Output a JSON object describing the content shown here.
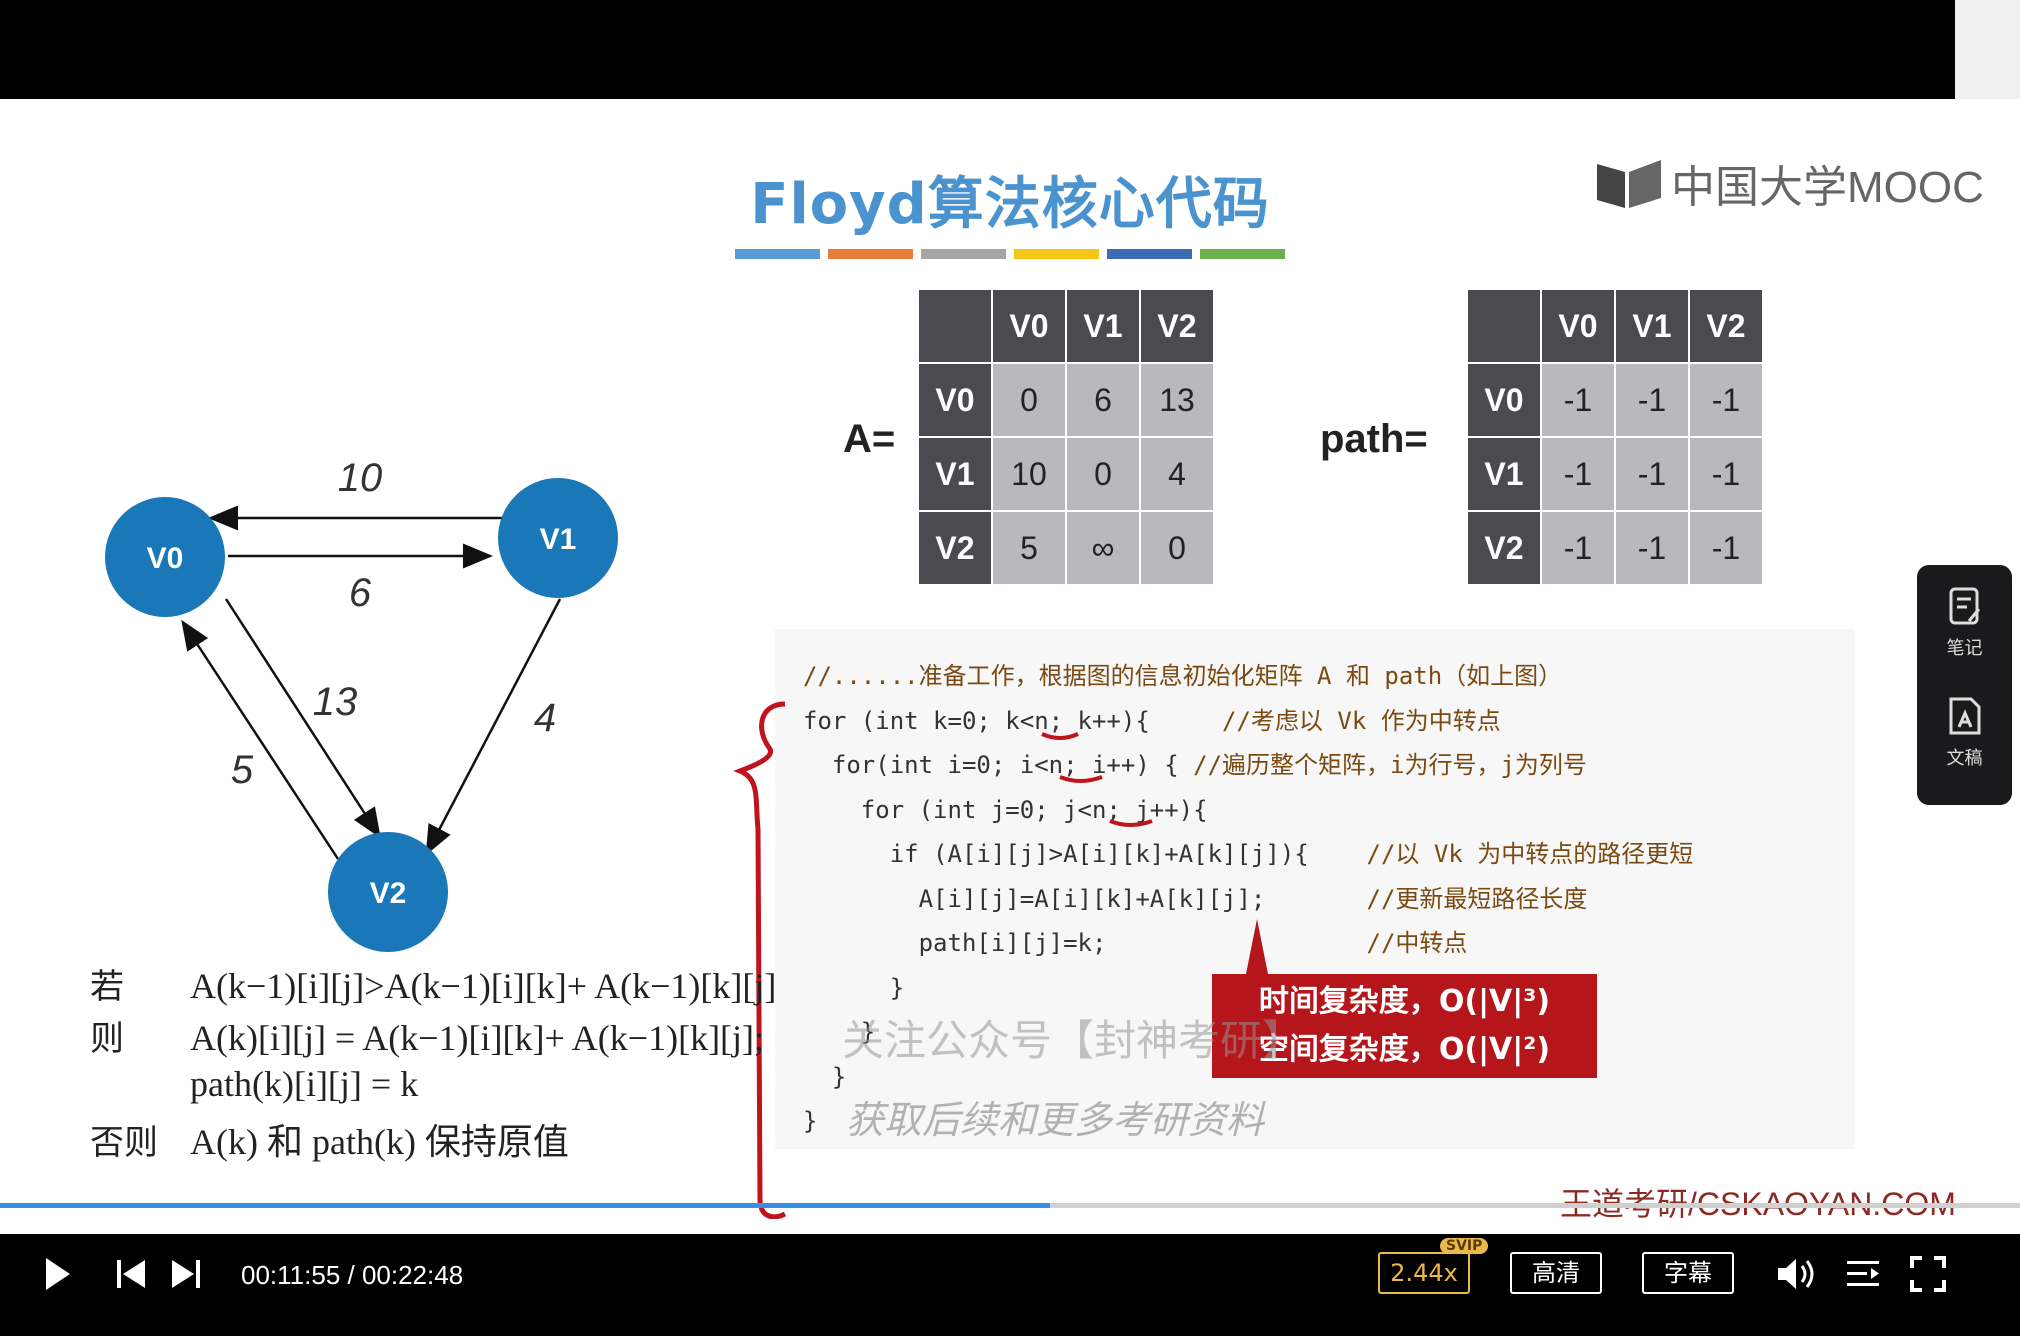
{
  "slide": {
    "title": "Floyd算法核心代码",
    "logo_text": "中国大学MOOC",
    "color_bars": [
      "#5b9bd5",
      "#e87e3a",
      "#a5a5a5",
      "#f5c518",
      "#3c6bb5",
      "#6ab04c"
    ],
    "graph": {
      "nodes": [
        "V0",
        "V1",
        "V2"
      ],
      "edge_labels": [
        "10",
        "6",
        "13",
        "4",
        "5"
      ]
    },
    "matrix_A": {
      "label": "A=",
      "headers": [
        "V0",
        "V1",
        "V2"
      ],
      "rows": [
        {
          "head": "V0",
          "cells": [
            "0",
            "6",
            "13"
          ]
        },
        {
          "head": "V1",
          "cells": [
            "10",
            "0",
            "4"
          ]
        },
        {
          "head": "V2",
          "cells": [
            "5",
            "∞",
            "0"
          ]
        }
      ]
    },
    "matrix_path": {
      "label": "path=",
      "headers": [
        "V0",
        "V1",
        "V2"
      ],
      "rows": [
        {
          "head": "V0",
          "cells": [
            "-1",
            "-1",
            "-1"
          ]
        },
        {
          "head": "V1",
          "cells": [
            "-1",
            "-1",
            "-1"
          ]
        },
        {
          "head": "V2",
          "cells": [
            "-1",
            "-1",
            "-1"
          ]
        }
      ]
    },
    "code": {
      "line1": "//......准备工作，根据图的信息初始化矩阵 A 和 path（如上图）",
      "line2_code": "for (int k=0; k<n; k++){",
      "line2_comment": "//考虑以 Vk 作为中转点",
      "line3_code": "  for(int i=0; i<n; i++) {",
      "line3_comment": "//遍历整个矩阵，i为行号，j为列号",
      "line4_code": "    for (int j=0; j<n; j++){",
      "line5_code": "      if (A[i][j]>A[i][k]+A[k][j]){",
      "line5_comment": "//以 Vk 为中转点的路径更短",
      "line6_code": "        A[i][j]=A[i][k]+A[k][j];",
      "line6_comment": "//更新最短路径长度",
      "line7_code": "        path[i][j]=k;",
      "line7_comment": "//中转点",
      "line8_code": "      }",
      "line9_code": "    }",
      "line10_code": "  }",
      "line11_code": "}"
    },
    "annotation": {
      "time_complexity": "时间复杂度，O(|V|³)",
      "space_complexity": "空间复杂度，O(|V|²)"
    },
    "watermark": {
      "line1": "关注公众号【封神考研】",
      "line2": "获取后续和更多考研资料"
    },
    "formula": {
      "if_label": "若",
      "if_expr": "A(k−1)[i][j]>A(k−1)[i][k]+ A(k−1)[k][j]",
      "then_label": "则",
      "then_expr1": "A(k)[i][j] = A(k−1)[i][k]+ A(k−1)[k][j];",
      "then_expr2": "path(k)[i][j] = k",
      "else_label": "否则",
      "else_expr": "A(k) 和 path(k) 保持原值"
    },
    "footer_brand": "王道考研/CSKAOYAN.COM"
  },
  "side_panel": {
    "notes_label": "笔记",
    "docs_label": "文稿"
  },
  "player": {
    "current_time": "00:11:55",
    "total_time": "00:22:48",
    "time_separator": " / ",
    "progress_fraction": 0.52,
    "speed_label": "2.44x",
    "svip_badge": "SVIP",
    "quality_label": "高清",
    "subtitle_label": "字幕"
  }
}
